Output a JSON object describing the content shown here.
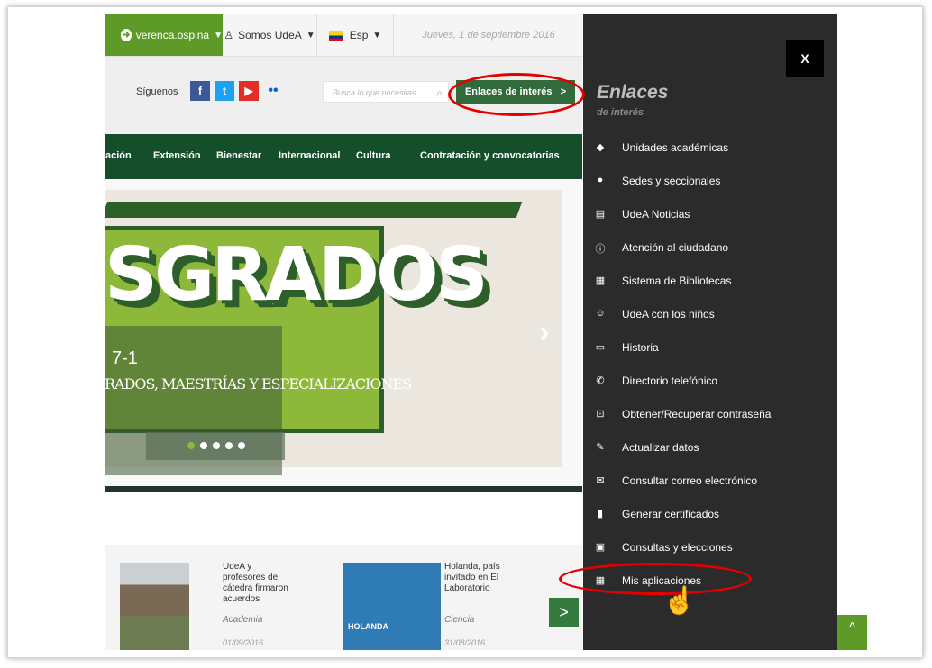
{
  "topbar": {
    "user": "verenca.ospina",
    "somos": "Somos UdeA",
    "lang": "Esp",
    "date": "Jueves, 1 de septiembre 2016"
  },
  "social": {
    "label": "Síguenos",
    "icons": [
      "facebook-icon",
      "twitter-icon",
      "youtube-icon",
      "flickr-icon"
    ]
  },
  "search": {
    "placeholder": "Busca lo que necesitas"
  },
  "enlaces_button": "Enlaces de interés",
  "nav": [
    "ación",
    "Extensión",
    "Bienestar",
    "Internacional",
    "Cultura",
    "Contratación y convocatorias"
  ],
  "hero": {
    "title": "SGRADOS",
    "caption_title": "7-1",
    "caption_sub": "RADOS, MAESTRÍAS Y ESPECIALIZACIONES"
  },
  "news": [
    {
      "text": "UdeA y profesores de cátedra firmaron acuerdos",
      "category": "Academia",
      "date": "01/09/2016"
    },
    {
      "text": "Holanda, país invitado en El Laboratorio",
      "category": "Ciencia",
      "date": "31/08/2016",
      "thumb_text": "HOLANDA"
    }
  ],
  "panel": {
    "close": "X",
    "title": "Enlaces",
    "subtitle": "de interés",
    "items": [
      {
        "icon": "tag-icon",
        "glyph": "◆",
        "label": "Unidades académicas"
      },
      {
        "icon": "location-icon",
        "glyph": "●",
        "label": "Sedes y seccionales"
      },
      {
        "icon": "document-icon",
        "glyph": "▤",
        "label": "UdeA Noticias"
      },
      {
        "icon": "info-icon",
        "glyph": "ⓘ",
        "label": "Atención al ciudadano"
      },
      {
        "icon": "grid-icon",
        "glyph": "▦",
        "label": "Sistema de Bibliotecas"
      },
      {
        "icon": "smile-icon",
        "glyph": "☺",
        "label": "UdeA con los niños"
      },
      {
        "icon": "book-icon",
        "glyph": "▭",
        "label": "Historia"
      },
      {
        "icon": "phone-icon",
        "glyph": "✆",
        "label": "Directorio telefónico"
      },
      {
        "icon": "lock-icon",
        "glyph": "⊡",
        "label": "Obtener/Recuperar contraseña"
      },
      {
        "icon": "pencil-icon",
        "glyph": "✎",
        "label": "Actualizar datos"
      },
      {
        "icon": "mail-icon",
        "glyph": "✉",
        "label": "Consultar correo electrónico"
      },
      {
        "icon": "certificate-icon",
        "glyph": "▮",
        "label": "Generar certificados"
      },
      {
        "icon": "ballot-icon",
        "glyph": "▣",
        "label": "Consultas y elecciones"
      },
      {
        "icon": "apps-icon",
        "glyph": "▦",
        "label": "Mis aplicaciones"
      }
    ]
  },
  "colors": {
    "brand_green": "#5d9a28",
    "nav_green": "#154e2b",
    "panel_bg": "#2b2b2b",
    "annotation_red": "#e50000"
  }
}
